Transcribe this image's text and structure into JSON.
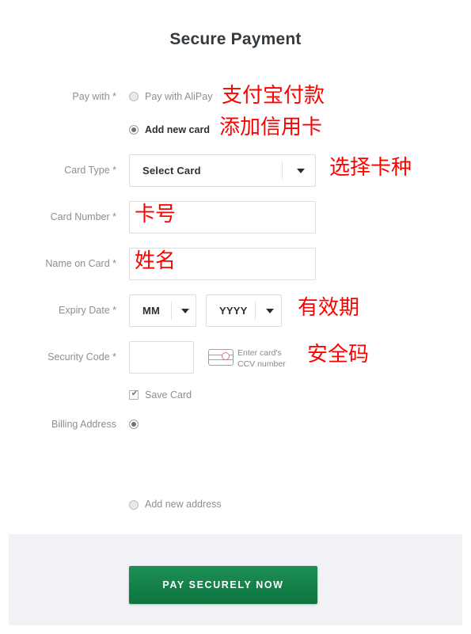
{
  "page": {
    "title": "Secure Payment"
  },
  "pay_with": {
    "label": "Pay with *",
    "options": [
      {
        "label": "Pay with AliPay",
        "selected": false,
        "annotation": "支付宝付款"
      },
      {
        "label": "Add new card",
        "selected": true,
        "annotation": "添加信用卡"
      }
    ]
  },
  "card_type": {
    "label": "Card Type *",
    "value": "Select Card",
    "annotation": "选择卡种",
    "chevron_icon": "chevron-down-icon"
  },
  "card_number": {
    "label": "Card Number *",
    "value": "",
    "annotation": "卡号"
  },
  "name_on_card": {
    "label": "Name on Card *",
    "value": "",
    "annotation": "姓名"
  },
  "expiry": {
    "label": "Expiry Date *",
    "month_value": "MM",
    "year_value": "YYYY",
    "annotation": "有效期"
  },
  "security_code": {
    "label": "Security Code *",
    "value": "",
    "hint_line1": "Enter card's",
    "hint_line2": "CCV number",
    "hint_icon": "credit-card-ccv-icon",
    "annotation": "安全码"
  },
  "save_card": {
    "label": "Save Card",
    "checked": true
  },
  "billing_address": {
    "label": "Billing Address",
    "existing_selected": true,
    "add_new_label": "Add new address",
    "add_new_selected": false
  },
  "footer": {
    "pay_button_label": "PAY SECURELY NOW",
    "button_color": "#16834b",
    "panel_color": "#f1f2f6"
  },
  "colors": {
    "annotation_red": "#ff0000",
    "label_gray": "#8b8f93",
    "title_dark": "#333a40",
    "field_border": "#dddddd"
  }
}
